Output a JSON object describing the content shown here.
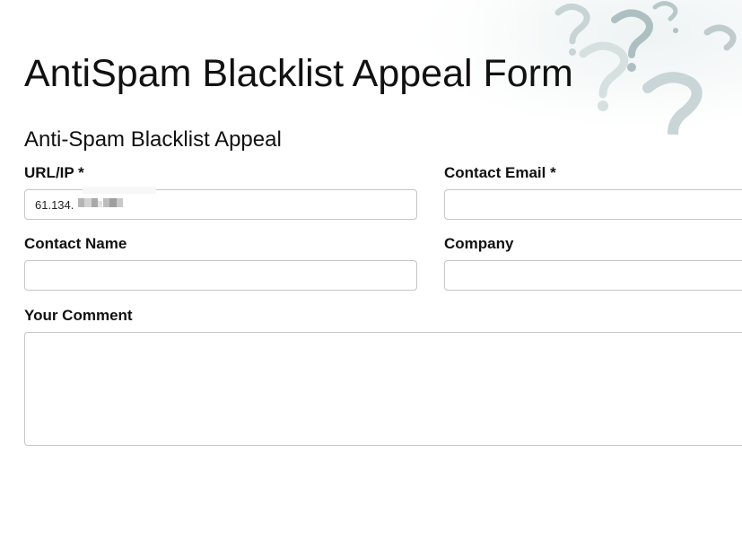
{
  "page": {
    "title": "AntiSpam Blacklist Appeal Form"
  },
  "form": {
    "section_title": "Anti-Spam Blacklist Appeal",
    "url_ip": {
      "label": "URL/IP *",
      "value": "61.134."
    },
    "contact_email": {
      "label": "Contact Email *",
      "value": ""
    },
    "contact_name": {
      "label": "Contact Name",
      "value": ""
    },
    "company": {
      "label": "Company",
      "value": ""
    },
    "comment": {
      "label": "Your Comment",
      "value": ""
    }
  },
  "decor": {
    "background_icon": "question-mark-icon"
  }
}
